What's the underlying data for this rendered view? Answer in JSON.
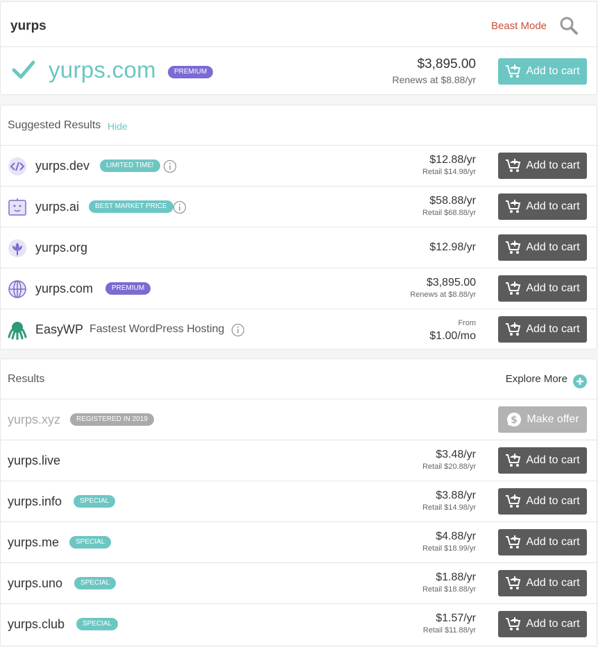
{
  "search": {
    "query": "yurps",
    "beast_mode": "Beast Mode"
  },
  "hero": {
    "domain": "yurps.com",
    "badge": "PREMIUM",
    "price": "$3,895.00",
    "renews": "Renews at $8.88/yr",
    "button": "Add to cart"
  },
  "suggested": {
    "title": "Suggested Results",
    "hide": "Hide",
    "items": [
      {
        "name": "yurps.dev",
        "icon": "code-icon",
        "badge": "LIMITED TIME!",
        "price": "$12.88/yr",
        "retail": "Retail $14.98/yr",
        "button": "Add to cart"
      },
      {
        "name": "yurps.ai",
        "icon": "robot-icon",
        "badge": "BEST MARKET PRICE",
        "price": "$58.88/yr",
        "retail": "Retail $68.88/yr",
        "button": "Add to cart"
      },
      {
        "name": "yurps.org",
        "icon": "org-lotus-icon",
        "price": "$12.98/yr",
        "button": "Add to cart"
      },
      {
        "name": "yurps.com",
        "icon": "globe-icon",
        "badge": "PREMIUM",
        "price": "$3,895.00",
        "retail": "Renews at $8.88/yr",
        "button": "Add to cart"
      },
      {
        "name": "EasyWP",
        "icon": "octopus-icon",
        "tagline": "Fastest WordPress Hosting",
        "from": "From",
        "price": "$1.00/mo",
        "button": "Add to cart"
      }
    ]
  },
  "results": {
    "title": "Results",
    "explore": "Explore More",
    "items": [
      {
        "name": "yurps.xyz",
        "badge": "REGISTERED IN 2019",
        "button": "Make offer"
      },
      {
        "name": "yurps.live",
        "price": "$3.48/yr",
        "retail": "Retail $20.88/yr",
        "button": "Add to cart"
      },
      {
        "name": "yurps.info",
        "badge": "SPECIAL",
        "price": "$3.88/yr",
        "retail": "Retail $14.98/yr",
        "button": "Add to cart"
      },
      {
        "name": "yurps.me",
        "badge": "SPECIAL",
        "price": "$4.88/yr",
        "retail": "Retail $18.99/yr",
        "button": "Add to cart"
      },
      {
        "name": "yurps.uno",
        "badge": "SPECIAL",
        "price": "$1.88/yr",
        "retail": "Retail $18.88/yr",
        "button": "Add to cart"
      },
      {
        "name": "yurps.club",
        "badge": "SPECIAL",
        "price": "$1.57/yr",
        "retail": "Retail $11.88/yr",
        "button": "Add to cart"
      }
    ]
  },
  "colors": {
    "teal": "#6cc6c3",
    "premium_purple": "#7b6bd2",
    "button_grey": "#5b5b5b",
    "beast_red": "#cc4e3b"
  }
}
